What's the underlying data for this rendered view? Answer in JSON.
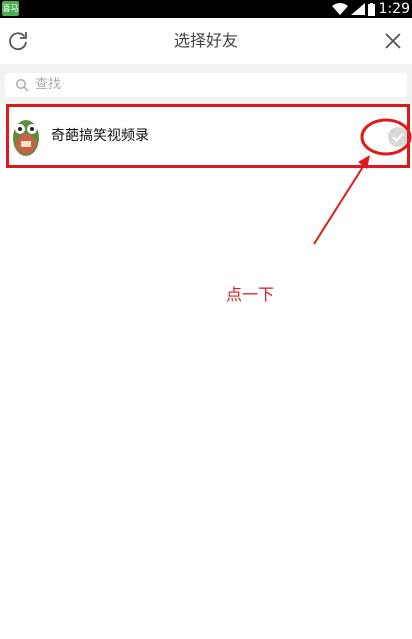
{
  "status_bar": {
    "app_icon_label": "喜马",
    "time": "1:29"
  },
  "header": {
    "title": "选择好友"
  },
  "search": {
    "placeholder": "查找"
  },
  "contacts": [
    {
      "name": "奇葩搞笑视频录",
      "selected": false
    }
  ],
  "annotation": {
    "text": "点一下",
    "color": "#d62020"
  },
  "colors": {
    "highlight": "#e01a1a",
    "search_bg": "#f2f2f2"
  }
}
